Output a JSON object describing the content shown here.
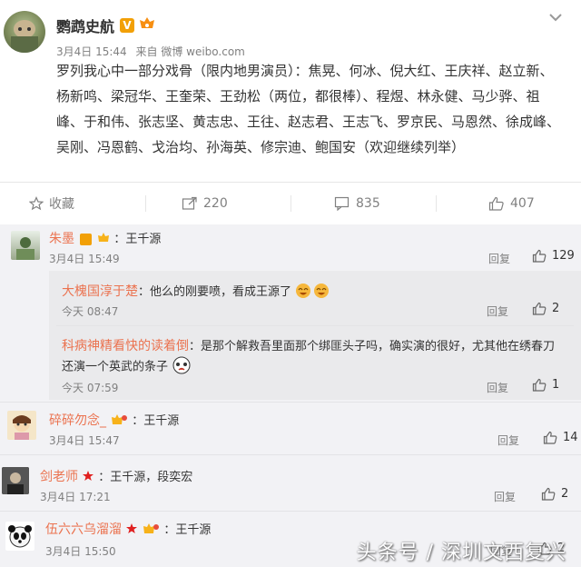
{
  "post": {
    "author": "鹦鹉史航",
    "verified_mark": "V",
    "time": "3月4日 15:44",
    "source": "来自 微博 weibo.com",
    "text": "罗列我心中一部分戏骨（限内地男演员）：焦晃、何冰、倪大红、王庆祥、赵立新、杨新鸣、梁冠华、王奎荣、王劲松（两位，都很棒）、程煜、林永健、马少骅、祖峰、于和伟、张志坚、黄志忠、王往、赵志君、王志飞、罗京民、马恩然、徐成峰、吴刚、冯恩鹤、戈治均、孙海英、修宗迪、鲍国安（欢迎继续列举）"
  },
  "actions": {
    "favorite_label": "收藏",
    "repost_count": "220",
    "comment_count": "835",
    "like_count": "407"
  },
  "comments": [
    {
      "user": "朱墨",
      "text": "：王千源",
      "time": "3月4日 15:49",
      "reply": "回复",
      "likes": "129"
    },
    {
      "user": "碎碎勿念_",
      "text": "：王千源",
      "time": "3月4日 15:47",
      "reply": "回复",
      "likes": "14"
    },
    {
      "user": "剑老师",
      "text": "：王千源，段奕宏",
      "time": "3月4日 17:21",
      "reply": "回复",
      "likes": "2"
    },
    {
      "user": "伍六六乌溜溜",
      "text": "：王千源",
      "time": "3月4日 15:50",
      "reply": "回复",
      "likes": "2"
    }
  ],
  "replies": [
    {
      "user": "大槐国淳于楚",
      "text": "：他么的刚要喷，看成王源了",
      "time": "今天 08:47",
      "reply": "回复",
      "likes": "2"
    },
    {
      "user": "科病神精看快的读着倒",
      "text_line1": "：是那个解救吾里面那个绑匪头子吗，确实演的很好，尤其他在绣春刀",
      "text_line2": "还演一个英武的条子",
      "time": "今天 07:59",
      "reply": "回复",
      "likes": "1"
    }
  ],
  "watermark": "头条号 / 深圳文西复兴",
  "colors": {
    "name": "#eb7350",
    "muted": "#808080",
    "bg_comments": "#f2f2f5"
  }
}
